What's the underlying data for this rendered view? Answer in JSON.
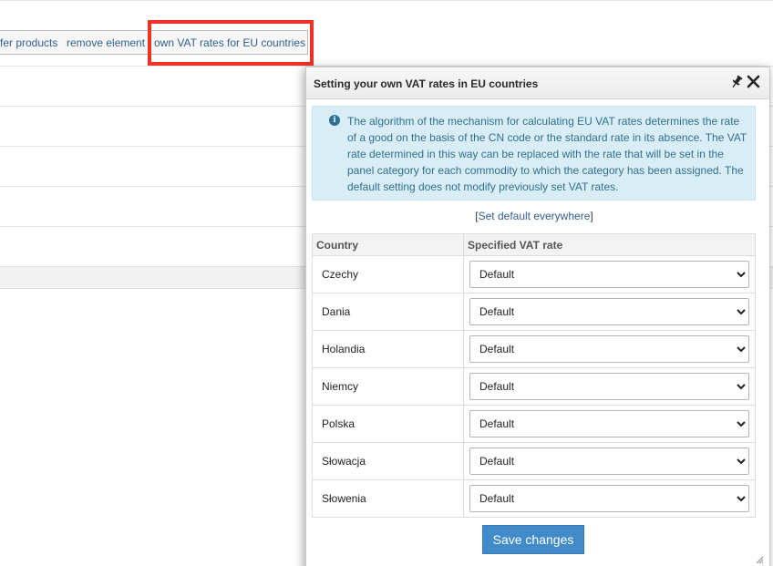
{
  "toolbar": {
    "links": [
      {
        "label": "fer products"
      },
      {
        "label": "remove element"
      },
      {
        "label": "own VAT rates for EU countries"
      }
    ]
  },
  "dialog": {
    "title": "Setting your own VAT rates in EU countries",
    "info_text": "The algorithm of the mechanism for calculating EU VAT rates determines the rate of a good on the basis of the CN code or the standard rate in its absence. The VAT rate determined in this way can be replaced with the rate that will be set in the panel category for each commodity to which the category has been assigned. The default setting does not modify previously set VAT rates.",
    "set_default_link": "Set default everywhere",
    "bracket_open": "[",
    "bracket_close": "]",
    "table": {
      "headers": {
        "country": "Country",
        "rate": "Specified VAT rate"
      },
      "rows": [
        {
          "country": "Czechy",
          "rate": "Default"
        },
        {
          "country": "Dania",
          "rate": "Default"
        },
        {
          "country": "Holandia",
          "rate": "Default"
        },
        {
          "country": "Niemcy",
          "rate": "Default"
        },
        {
          "country": "Polska",
          "rate": "Default"
        },
        {
          "country": "Słowacja",
          "rate": "Default"
        },
        {
          "country": "Słowenia",
          "rate": "Default"
        }
      ]
    },
    "save_label": "Save changes"
  },
  "colors": {
    "highlight": "#ee3224",
    "info_bg": "#d9edf7",
    "info_text": "#31708f",
    "primary_button": "#428bca",
    "link": "#2f5f91"
  },
  "icons": [
    "pin-icon",
    "close-icon",
    "info-icon",
    "chevron-down-icon",
    "resize-grip-icon"
  ]
}
